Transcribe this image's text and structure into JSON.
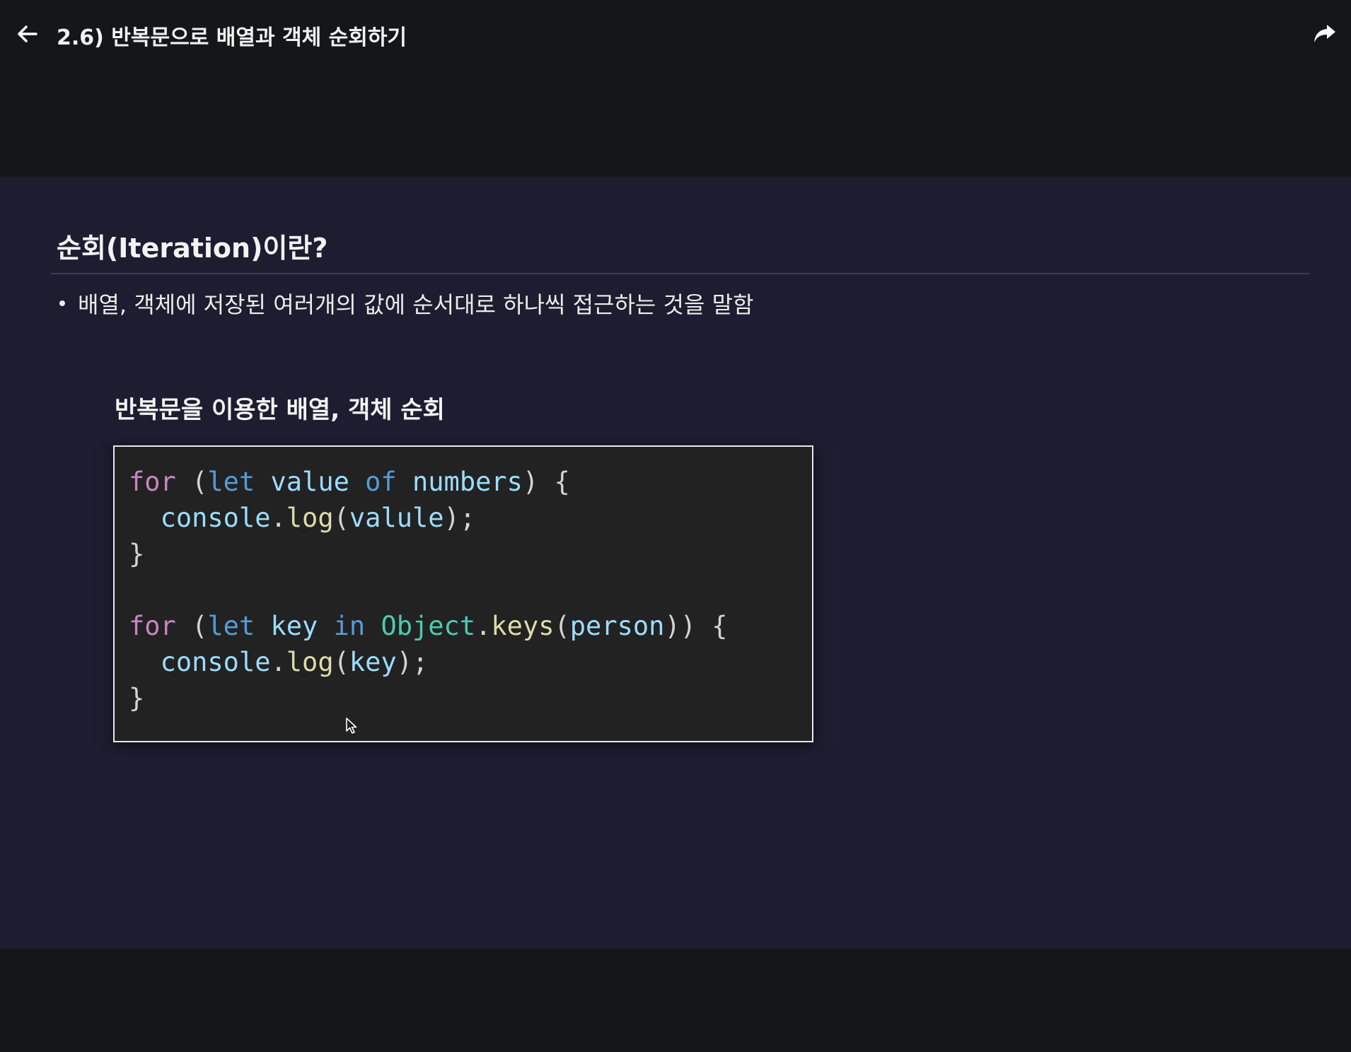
{
  "header": {
    "title": "2.6) 반복문으로 배열과 객체 순회하기",
    "back_icon": "arrow-left-icon",
    "share_icon": "share-forward-icon"
  },
  "slide": {
    "heading": "순회(Iteration)이란?",
    "bullet": "배열, 객체에 저장된 여러개의 값에 순서대로 하나씩 접근하는 것을 말함",
    "subheading": "반복문을 이용한 배열, 객체 순회",
    "code": {
      "l1": {
        "for": "for",
        "p1": " (",
        "let": "let",
        "v": " value ",
        "of": "of",
        "n": " numbers",
        "p2": ") {"
      },
      "l2": {
        "indent": "  ",
        "obj": "console",
        "dot": ".",
        "fn": "log",
        "p1": "(",
        "arg": "valule",
        "p2": ");"
      },
      "l3": {
        "brace": "}"
      },
      "l5": {
        "for": "for",
        "p1": " (",
        "let": "let",
        "v": " key ",
        "in": "in",
        "sp": " ",
        "cls": "Object",
        "dot": ".",
        "fn": "keys",
        "p2": "(",
        "arg": "person",
        "p3": ")) {"
      },
      "l6": {
        "indent": "  ",
        "obj": "console",
        "dot": ".",
        "fn": "log",
        "p1": "(",
        "arg": "key",
        "p2": ");"
      },
      "l7": {
        "brace": "}"
      }
    }
  },
  "colors": {
    "frame_bg": "#151619",
    "slide_bg": "#1c1d30",
    "code_bg": "#222222"
  }
}
